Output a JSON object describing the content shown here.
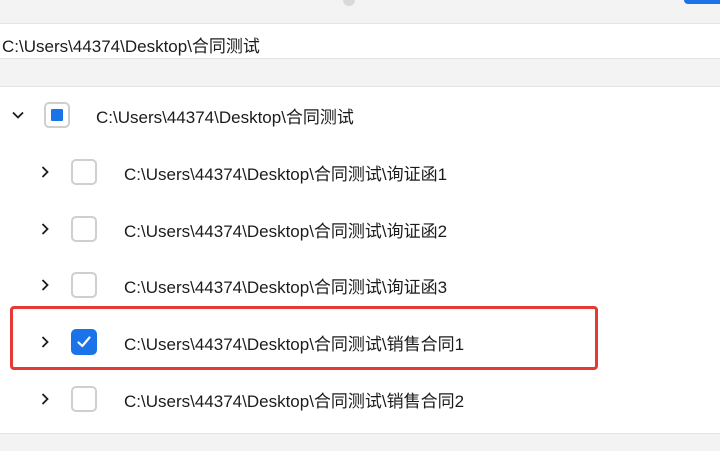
{
  "path_bar": {
    "value": "C:\\Users\\44374\\Desktop\\合同测试"
  },
  "tree": {
    "root": {
      "label": "C:\\Users\\44374\\Desktop\\合同测试",
      "expanded": true,
      "check_state": "indeterminate",
      "chevron_icon": "chevron-down-icon"
    },
    "children": [
      {
        "label": "C:\\Users\\44374\\Desktop\\合同测试\\询证函1",
        "checked": false,
        "chevron_icon": "chevron-right-icon"
      },
      {
        "label": "C:\\Users\\44374\\Desktop\\合同测试\\询证函2",
        "checked": false,
        "chevron_icon": "chevron-right-icon"
      },
      {
        "label": "C:\\Users\\44374\\Desktop\\合同测试\\询证函3",
        "checked": false,
        "chevron_icon": "chevron-right-icon"
      },
      {
        "label": "C:\\Users\\44374\\Desktop\\合同测试\\销售合同1",
        "checked": true,
        "chevron_icon": "chevron-right-icon"
      },
      {
        "label": "C:\\Users\\44374\\Desktop\\合同测试\\销售合同2",
        "checked": false,
        "chevron_icon": "chevron-right-icon"
      }
    ]
  },
  "colors": {
    "accent": "#1a73e8",
    "highlight": "#e53935",
    "checkbox_border": "#cfcfcf"
  }
}
